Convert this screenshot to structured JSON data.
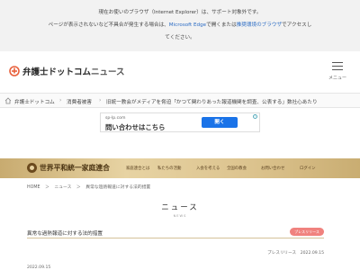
{
  "ie_notice": {
    "line1": "現在お使いのブラウザ（Internet Explorer）は、サポート対象外です。",
    "line2_prefix": "ページが表示されないなど不具合が発生する場合は、",
    "line2_link1": "Microsoft Edge",
    "line2_mid": "で開く",
    "line2_or": "または",
    "line2_link2": "推奨環境のブラウザ",
    "line2_suffix": "でアクセスし",
    "line3": "てください。"
  },
  "header": {
    "logo_main": "弁護士ドットコム",
    "logo_news": "ニュース",
    "menu_label": "メニュー"
  },
  "breadcrumb": {
    "items": [
      "弁護士ドットコム",
      "消費者被害",
      "旧統一教会がメディアを脅迫「かつて関わりあった報道機関を調査、公表する」数社心あたり"
    ]
  },
  "ad": {
    "domain": "sp-lp.com",
    "title": "問い合わせはこちら",
    "button": "開く",
    "info": "i"
  },
  "ffwpu": {
    "name": "世界平和統一家庭連合",
    "nav": [
      "家庭連合とは",
      "私たちの活動",
      "入会を考える",
      "全国の教会",
      "お問い合わせ",
      "ログイン"
    ]
  },
  "sub_breadcrumb": [
    "HOME",
    "ニュース",
    "異常な過熱報道に対する法的措置"
  ],
  "news_heading": {
    "jp": "ニュース",
    "en": "NEWS"
  },
  "news_item": {
    "title": "異常な過熱報道に対する法的措置",
    "badge": "プレスリリース"
  },
  "release": {
    "meta": "プレスリリース　2022.09.15",
    "date": "2022.09.15"
  },
  "colors": {
    "link": "#2b6cc4",
    "badge": "#f0827e",
    "ad_button": "#1a73e8",
    "band": "#dcc38e"
  }
}
